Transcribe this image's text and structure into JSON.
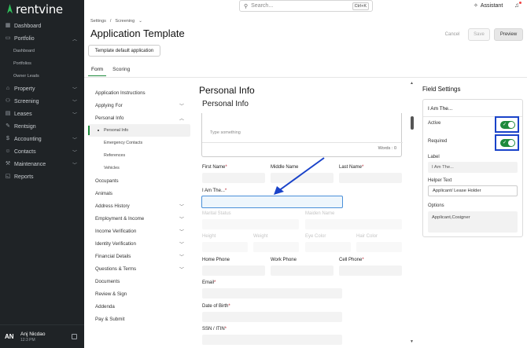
{
  "brand": {
    "name": "rentvine"
  },
  "sidebar": {
    "items": [
      {
        "label": "Dashboard",
        "icon": "dashboard-icon"
      },
      {
        "label": "Portfolio",
        "icon": "portfolio-icon",
        "expanded": true
      },
      {
        "label": "Property",
        "icon": "property-icon"
      },
      {
        "label": "Screening",
        "icon": "screening-icon"
      },
      {
        "label": "Leases",
        "icon": "leases-icon"
      },
      {
        "label": "Rentsign",
        "icon": "rentsign-icon"
      },
      {
        "label": "Accounting",
        "icon": "accounting-icon"
      },
      {
        "label": "Contacts",
        "icon": "contacts-icon"
      },
      {
        "label": "Maintenance",
        "icon": "maintenance-icon"
      },
      {
        "label": "Reports",
        "icon": "reports-icon"
      }
    ],
    "portfolio_sub": [
      "Dashboard",
      "Portfolios",
      "Owner Leads"
    ],
    "user": {
      "initials": "AN",
      "name": "Anj Nicdao",
      "time": "12:3 PM"
    }
  },
  "topbar": {
    "search_placeholder": "Search...",
    "search_shortcut": "Ctrl+K",
    "assistant_label": "Assistant"
  },
  "header": {
    "breadcrumb": [
      "Settings",
      "/",
      "Screening"
    ],
    "title": "Application Template",
    "cancel": "Cancel",
    "save": "Save",
    "preview": "Preview",
    "template_button": "Template default application",
    "tabs": [
      "Form",
      "Scoring"
    ],
    "active_tab": "Form"
  },
  "form_nav": {
    "items": [
      {
        "label": "Application Instructions"
      },
      {
        "label": "Applying For",
        "chevron": "down"
      },
      {
        "label": "Personal Info",
        "chevron": "up"
      }
    ],
    "personal_sub": [
      {
        "label": "Personal Info",
        "active": true
      },
      {
        "label": "Emergency Contacts"
      },
      {
        "label": "References"
      },
      {
        "label": "Vehicles"
      }
    ],
    "items_after": [
      {
        "label": "Occupants"
      },
      {
        "label": "Animals"
      },
      {
        "label": "Address History",
        "chevron": "down"
      },
      {
        "label": "Employment & Income",
        "chevron": "down"
      },
      {
        "label": "Income Verification",
        "chevron": "down"
      },
      {
        "label": "Identity Verification",
        "chevron": "down"
      },
      {
        "label": "Financial Details",
        "chevron": "down"
      },
      {
        "label": "Questions & Terms",
        "chevron": "down"
      },
      {
        "label": "Documents"
      },
      {
        "label": "Review & Sign"
      },
      {
        "label": "Addenda"
      },
      {
        "label": "Pay & Submit"
      }
    ]
  },
  "form": {
    "section_title": "Personal Info",
    "section_subtitle": "Personal Info",
    "editor_placeholder": "Type something",
    "word_count": "Words : 0",
    "fields": {
      "first_name": "First Name",
      "middle_name": "Middle Name",
      "last_name": "Last Name",
      "i_am_the": "I Am The...",
      "marital_status": "Marital Status",
      "maiden_name": "Maiden Name",
      "height": "Height",
      "weight": "Weight",
      "eye_color": "Eye Color",
      "hair_color": "Hair Color",
      "home_phone": "Home Phone",
      "work_phone": "Work Phone",
      "cell_phone": "Cell Phone",
      "email": "Email",
      "dob": "Date of Birth",
      "ssn": "SSN / ITIN"
    },
    "required_mark": "*"
  },
  "field_settings": {
    "title": "Field Settings",
    "heading": "I Am The...",
    "active_label": "Active",
    "active_on": true,
    "required_label": "Required",
    "required_on": true,
    "label_label": "Label",
    "label_value": "I Am The...",
    "helper_label": "Helper Text",
    "helper_value": "Applicant/ Lease Holder",
    "options_label": "Options",
    "options_value": "Applicant,Cosigner",
    "highlight_color": "#1a43c9",
    "accent_color": "#1e8a3c"
  }
}
